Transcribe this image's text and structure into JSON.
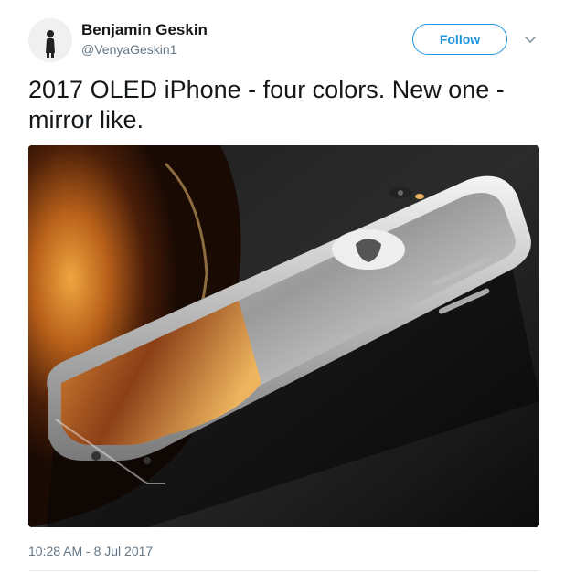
{
  "tweet": {
    "author": {
      "display_name": "Benjamin Geskin",
      "handle": "@VenyaGeskin1",
      "avatar_icon": "avatar-silhouette"
    },
    "follow_label": "Follow",
    "menu_icon": "chevron-down-icon",
    "text": "2017 OLED iPhone - four colors. New one - mirror like.",
    "media": {
      "description_icon": "photo"
    },
    "timestamp": "10:28 AM - 8 Jul 2017"
  },
  "colors": {
    "accent": "#1b95e0",
    "text": "#14171a",
    "secondary": "#657786"
  }
}
